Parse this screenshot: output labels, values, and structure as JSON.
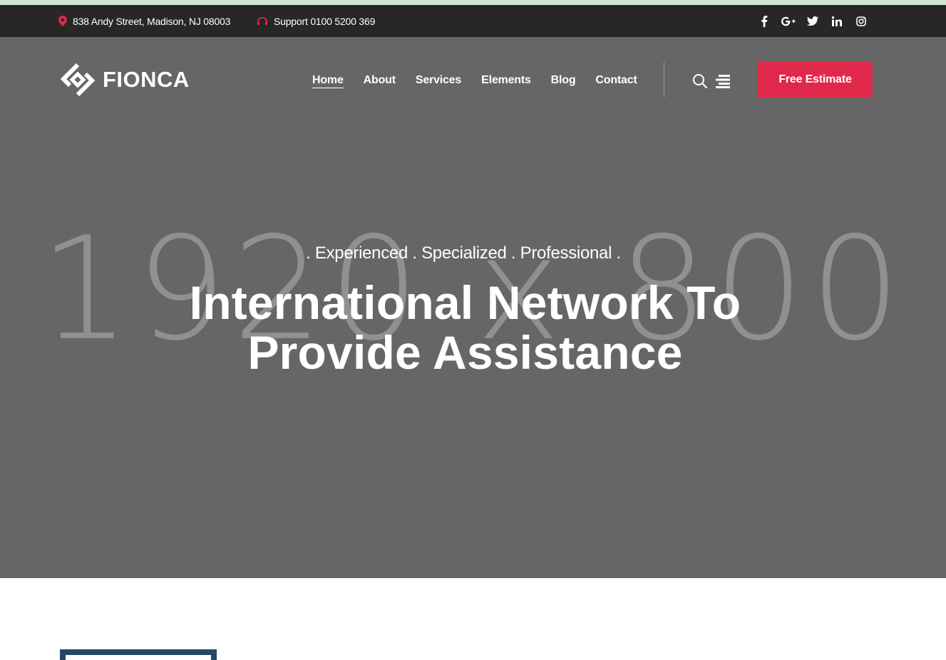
{
  "topbar": {
    "address": "838 Andy Street, Madison, NJ 08003",
    "support": "Support 0100 5200 369",
    "social": [
      {
        "icon": "facebook-icon",
        "glyph": "f"
      },
      {
        "icon": "google-plus-icon",
        "glyph": "G+"
      },
      {
        "icon": "twitter-icon",
        "glyph": ""
      },
      {
        "icon": "linkedin-icon",
        "glyph": "in"
      },
      {
        "icon": "instagram-icon",
        "glyph": ""
      }
    ]
  },
  "header": {
    "logo_text": "FIONCA",
    "nav": [
      "Home",
      "About",
      "Services",
      "Elements",
      "Blog",
      "Contact"
    ],
    "active_nav": "Home",
    "cta_label": "Free Estimate"
  },
  "hero": {
    "kicker": ". Experienced .  Specialized .  Professional .",
    "title_line1": "International Network To",
    "title_line2": "Provide Assistance",
    "placeholder_dims": "1920 x 800"
  },
  "colors": {
    "accent": "#e0294a",
    "topbar_bg": "#272727",
    "hero_bg": "#666666",
    "box_border": "#264766"
  }
}
